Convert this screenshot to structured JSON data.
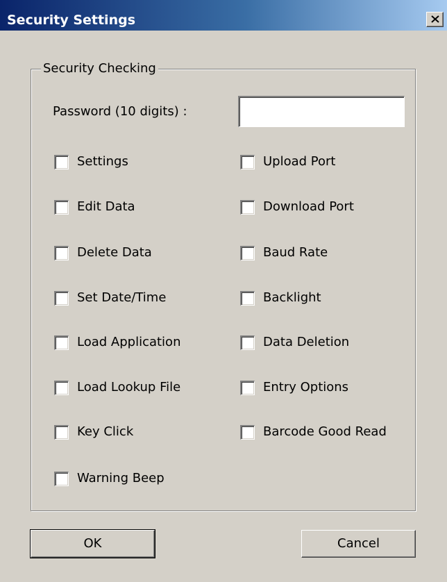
{
  "window": {
    "title": "Security Settings"
  },
  "close_button": {
    "icon": "close-icon"
  },
  "group": {
    "label": "Security Checking",
    "password_label": "Password (10 digits) :",
    "password_value": ""
  },
  "checkboxes": {
    "left": [
      {
        "label": "Settings",
        "checked": false
      },
      {
        "label": "Edit Data",
        "checked": false
      },
      {
        "label": "Delete Data",
        "checked": false
      },
      {
        "label": "Set Date/Time",
        "checked": false
      },
      {
        "label": "Load Application",
        "checked": false
      },
      {
        "label": "Load Lookup File",
        "checked": false
      },
      {
        "label": "Key Click",
        "checked": false
      },
      {
        "label": "Warning Beep",
        "checked": false
      }
    ],
    "right": [
      {
        "label": "Upload Port",
        "checked": false
      },
      {
        "label": "Download Port",
        "checked": false
      },
      {
        "label": "Baud Rate",
        "checked": false
      },
      {
        "label": "Backlight",
        "checked": false
      },
      {
        "label": "Data Deletion",
        "checked": false
      },
      {
        "label": "Entry Options",
        "checked": false
      },
      {
        "label": "Barcode Good Read",
        "checked": false
      }
    ]
  },
  "buttons": {
    "ok_label": "OK",
    "cancel_label": "Cancel"
  }
}
